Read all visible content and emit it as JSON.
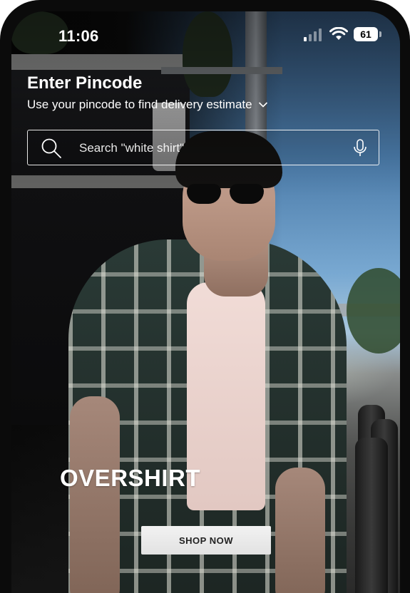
{
  "status_bar": {
    "time": "11:06",
    "battery_level": "61",
    "icons": [
      "cellular-signal-icon",
      "wifi-icon",
      "battery-icon"
    ]
  },
  "header": {
    "title": "Enter Pincode",
    "subtitle": "Use your pincode to find delivery estimate"
  },
  "search": {
    "placeholder": "Search \"white shirt\"",
    "icons": [
      "search-icon",
      "microphone-icon"
    ]
  },
  "hero": {
    "title": "OVERSHIRT",
    "cta_label": "SHOP NOW"
  },
  "colors": {
    "text": "#ffffff",
    "cta_background": "#eeeeee",
    "cta_text": "#222222"
  }
}
